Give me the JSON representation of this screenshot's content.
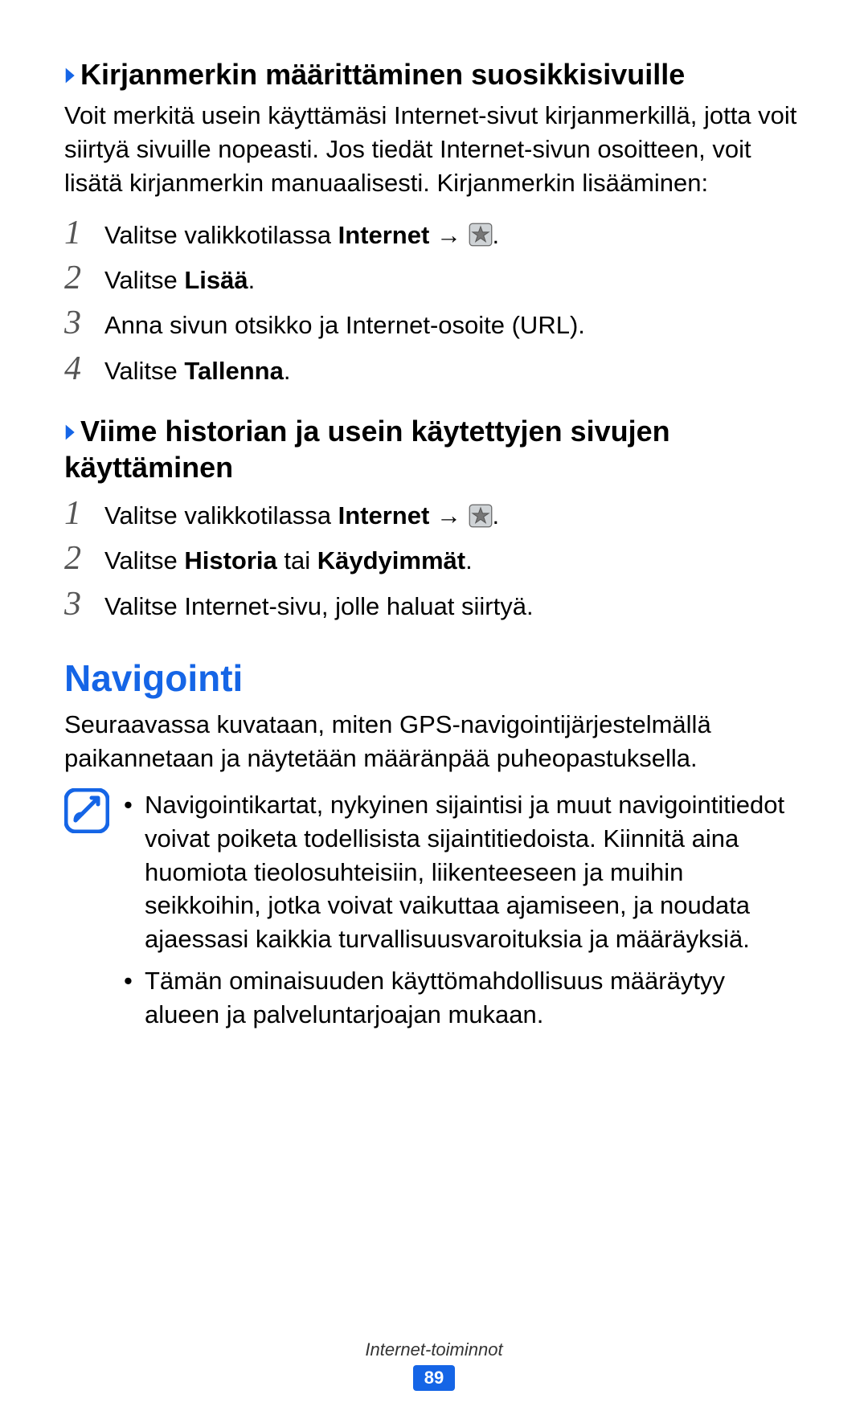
{
  "section1": {
    "heading": "Kirjanmerkin määrittäminen suosikkisivuille",
    "intro": "Voit merkitä usein käyttämäsi Internet-sivut kirjanmerkillä, jotta voit siirtyä sivuille nopeasti. Jos tiedät Internet-sivun osoitteen, voit lisätä kirjanmerkin manuaalisesti. Kirjanmerkin lisääminen:",
    "steps": {
      "s1_pre": "Valitse valikkotilassa ",
      "s1_bold": "Internet",
      "s1_arrow": " → ",
      "s1_post": ".",
      "s2_pre": "Valitse ",
      "s2_bold": "Lisää",
      "s2_post": ".",
      "s3": "Anna sivun otsikko ja Internet-osoite (URL).",
      "s4_pre": "Valitse ",
      "s4_bold": "Tallenna",
      "s4_post": "."
    }
  },
  "section2": {
    "heading": "Viime historian ja usein käytettyjen sivujen käyttäminen",
    "steps": {
      "s1_pre": "Valitse valikkotilassa ",
      "s1_bold": "Internet",
      "s1_arrow": " → ",
      "s1_post": ".",
      "s2_pre": "Valitse ",
      "s2_bold1": "Historia",
      "s2_mid": " tai ",
      "s2_bold2": "Käydyimmät",
      "s2_post": ".",
      "s3": "Valitse Internet-sivu, jolle haluat siirtyä."
    }
  },
  "section3": {
    "title": "Navigointi",
    "intro": "Seuraavassa kuvataan, miten GPS-navigointijärjestelmällä paikannetaan ja näytetään määränpää puheopastuksella.",
    "notes": {
      "n1": "Navigointikartat, nykyinen sijaintisi ja muut navigointitiedot voivat poiketa todellisista sijaintitiedoista. Kiinnitä aina huomiota tieolosuhteisiin, liikenteeseen ja muihin seikkoihin, jotka voivat vaikuttaa ajamiseen, ja noudata ajaessasi kaikkia turvallisuusvaroituksia ja määräyksiä.",
      "n2": "Tämän ominaisuuden käyttömahdollisuus määräytyy alueen ja palveluntarjoajan mukaan."
    }
  },
  "footer": {
    "category": "Internet-toiminnot",
    "page": "89"
  },
  "nums": {
    "n1": "1",
    "n2": "2",
    "n3": "3",
    "n4": "4"
  },
  "bullet": "•"
}
